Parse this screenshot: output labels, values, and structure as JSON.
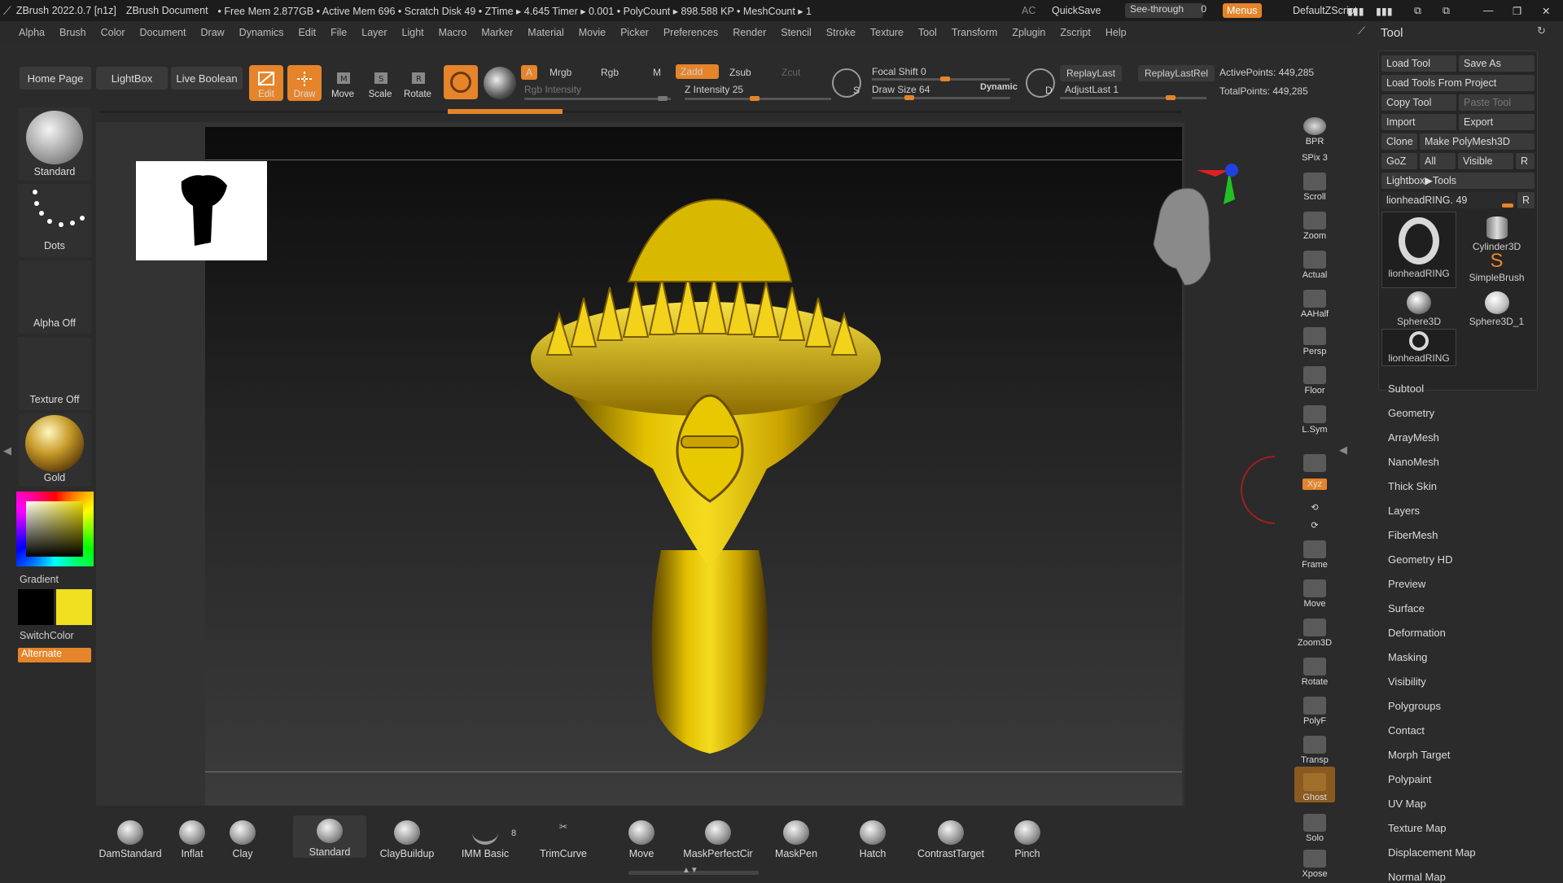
{
  "titlebar": {
    "app": "ZBrush 2022.0.7 [n1z]",
    "document": "ZBrush Document",
    "stats": "• Free Mem 2.877GB • Active Mem 696 • Scratch Disk 49 • ZTime ▸ 4.645 Timer ▸ 0.001 • PolyCount ▸ 898.588 KP • MeshCount ▸ 1",
    "ac": "AC",
    "quicksave": "QuickSave",
    "see_through": "See-through",
    "see_through_value": "0",
    "menus": "Menus",
    "default_zscript": "DefaultZScript"
  },
  "menubar": {
    "items": [
      "Alpha",
      "Brush",
      "Color",
      "Document",
      "Draw",
      "Dynamics",
      "Edit",
      "File",
      "Layer",
      "Light",
      "Macro",
      "Marker",
      "Material",
      "Movie",
      "Picker",
      "Preferences",
      "Render",
      "Stencil",
      "Stroke",
      "Texture",
      "Tool",
      "Transform",
      "Zplugin",
      "Zscript",
      "Help"
    ]
  },
  "toolbar": {
    "home_page": "Home Page",
    "lightbox": "LightBox",
    "live_boolean": "Live Boolean",
    "edit": "Edit",
    "draw": "Draw",
    "move": "Move",
    "scale": "Scale",
    "rotate": "Rotate",
    "a": "A",
    "mrgb": "Mrgb",
    "rgb": "Rgb",
    "m": "M",
    "zadd": "Zadd",
    "zsub": "Zsub",
    "zcut": "Zcut",
    "rgb_intensity": "Rgb Intensity",
    "z_intensity": "Z Intensity 25",
    "focal_shift": "Focal Shift 0",
    "draw_size": "Draw Size 64",
    "dynamic": "Dynamic",
    "replay_last": "ReplayLast",
    "replay_last_rel": "ReplayLastRel",
    "adjust_last": "AdjustLast 1",
    "active_points": "ActivePoints: 449,285",
    "total_points": "TotalPoints: 449,285",
    "s_label": "S",
    "d_label": "D"
  },
  "leftpanel": {
    "brush": "Standard",
    "stroke": "Dots",
    "alpha": "Alpha Off",
    "texture": "Texture Off",
    "material": "Gold",
    "gradient": "Gradient",
    "switchcolor": "SwitchColor",
    "alternate": "Alternate"
  },
  "rightstrip": {
    "items": [
      "BPR",
      "SPix 3",
      "Scroll",
      "Zoom",
      "Actual",
      "AAHalf",
      "Persp",
      "Floor",
      "L.Sym",
      "",
      "Xyz",
      "",
      "",
      "Frame",
      "Move",
      "Zoom3D",
      "Rotate",
      "PolyF",
      "Transp",
      "Ghost",
      "Solo",
      "Xpose"
    ]
  },
  "toolpanel": {
    "title": "Tool",
    "load_tool": "Load Tool",
    "save_as": "Save As",
    "load_tools_from_project": "Load Tools From Project",
    "copy_tool": "Copy Tool",
    "paste_tool": "Paste Tool",
    "import": "Import",
    "export": "Export",
    "clone": "Clone",
    "make_polymesh3d": "Make PolyMesh3D",
    "goz": "GoZ",
    "all": "All",
    "visible": "Visible",
    "r": "R",
    "lightbox_tools": "Lightbox▶Tools",
    "current_tool": "lionheadRING. 49",
    "thumbs": [
      "lionheadRING",
      "Cylinder3D",
      "SimpleBrush",
      "Sphere3D",
      "Sphere3D_1",
      "lionheadRING"
    ],
    "sections": [
      "Subtool",
      "Geometry",
      "ArrayMesh",
      "NanoMesh",
      "Thick Skin",
      "Layers",
      "FiberMesh",
      "Geometry HD",
      "Preview",
      "Surface",
      "Deformation",
      "Masking",
      "Visibility",
      "Polygroups",
      "Contact",
      "Morph Target",
      "Polypaint",
      "UV Map",
      "Texture Map",
      "Displacement Map",
      "Normal Map"
    ]
  },
  "bottombar": {
    "brushes": [
      "DamStandard",
      "Inflat",
      "Clay",
      "Standard",
      "ClayBuildup",
      "IMM Basic",
      "TrimCurve",
      "Move",
      "MaskPerfectCir",
      "MaskPen",
      "Hatch",
      "ContrastTarget",
      "Pinch"
    ],
    "imm_count": "8"
  },
  "colors": {
    "accent": "#e5842a",
    "gold": "#d4b000",
    "primary_color": "#000000",
    "secondary_color": "#f0e020"
  }
}
